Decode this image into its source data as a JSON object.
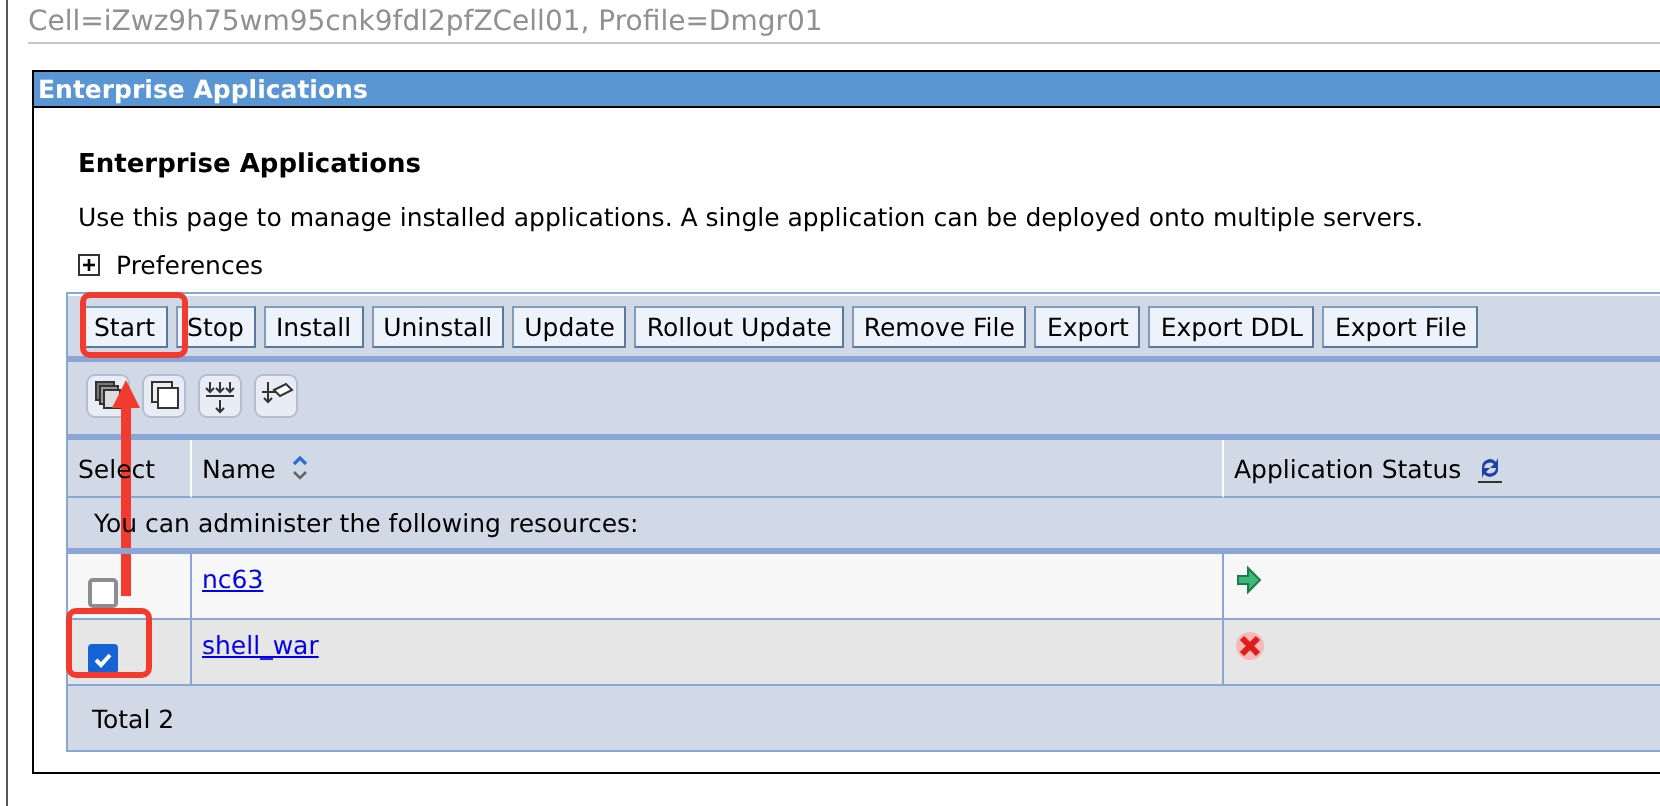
{
  "breadcrumb": "Cell=iZwz9h75wm95cnk9fdl2pfZCell01, Profile=Dmgr01",
  "panel": {
    "title": "Enterprise Applications"
  },
  "heading": "Enterprise Applications",
  "description": "Use this page to manage installed applications. A single application can be deployed onto multiple servers.",
  "preferences": {
    "label": "Preferences",
    "expanded": false
  },
  "buttons": [
    "Start",
    "Stop",
    "Install",
    "Uninstall",
    "Update",
    "Rollout Update",
    "Remove File",
    "Export",
    "Export DDL",
    "Export File"
  ],
  "table": {
    "columns": [
      "Select",
      "Name",
      "Application Status"
    ],
    "notice": "You can administer the following resources:",
    "rows": [
      {
        "checked": false,
        "name": "nc63",
        "running": true
      },
      {
        "checked": true,
        "name": "shell_war",
        "running": false
      }
    ],
    "total": "Total 2"
  }
}
